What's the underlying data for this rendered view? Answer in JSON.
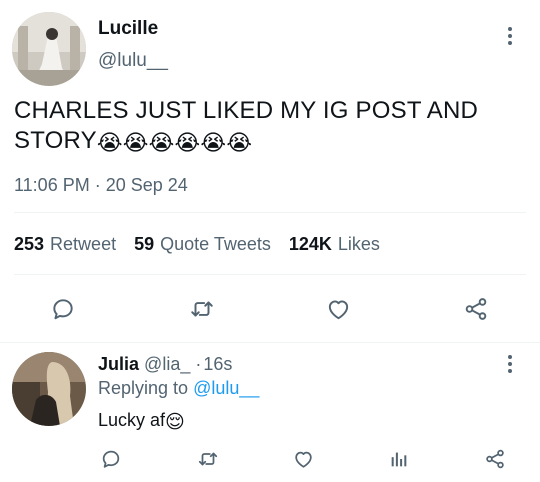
{
  "tweet": {
    "author_name": "Lucille",
    "author_handle": "@lulu__",
    "text": "CHARLES JUST LIKED MY IG POST AND STORY",
    "emoji": "😭😭😭😭😭😭",
    "timestamp": "11:06 PM · 20 Sep 24",
    "stats": {
      "retweets_count": "253",
      "retweets_label": "Retweet",
      "quotes_count": "59",
      "quotes_label": "Quote Tweets",
      "likes_count": "124K",
      "likes_label": "Likes"
    },
    "actions": [
      "reply-icon",
      "retweet-icon",
      "like-icon",
      "share-icon"
    ]
  },
  "reply": {
    "author_name": "Julia",
    "author_handle": "@lia_",
    "separator": "·",
    "age": "16s",
    "replying_prefix": "Replying to",
    "replying_handle": "@lulu__",
    "text": "Lucky af",
    "emoji": "😌",
    "actions": [
      "reply-icon",
      "retweet-icon",
      "like-icon",
      "analytics-icon",
      "share-icon"
    ]
  },
  "colors": {
    "text": "#0f1419",
    "secondary": "#536471",
    "link": "#1d9bf0",
    "divider": "#eff3f4"
  }
}
